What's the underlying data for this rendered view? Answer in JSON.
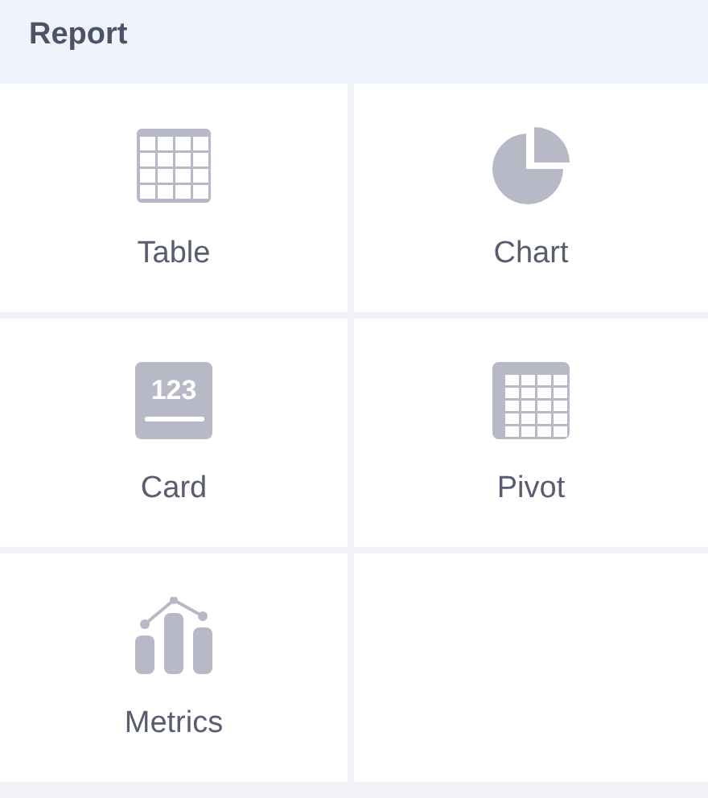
{
  "section": {
    "title": "Report"
  },
  "items": [
    {
      "kind": "table",
      "label": "Table"
    },
    {
      "kind": "chart",
      "label": "Chart"
    },
    {
      "kind": "card",
      "label": "Card",
      "icon_text": "123"
    },
    {
      "kind": "pivot",
      "label": "Pivot"
    },
    {
      "kind": "metrics",
      "label": "Metrics"
    }
  ]
}
